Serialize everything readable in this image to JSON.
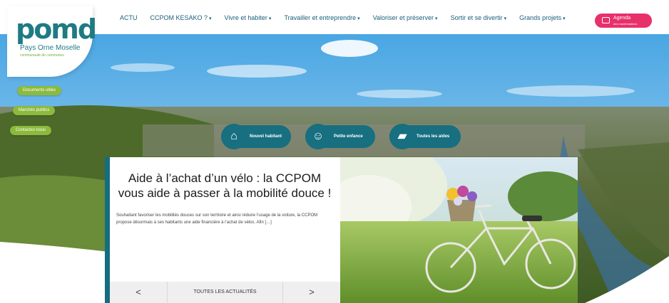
{
  "logo": {
    "mark": "pomd",
    "name": "Pays Orne Moselle",
    "tagline": "communauté de communes"
  },
  "nav": {
    "items": [
      {
        "label": "ACTU",
        "caret": false
      },
      {
        "label": "CCPOM KESAKO ?",
        "caret": true
      },
      {
        "label": "Vivre et habiter",
        "caret": true
      },
      {
        "label": "Travailler et entreprendre",
        "caret": true
      },
      {
        "label": "Valoriser et préserver",
        "caret": true
      },
      {
        "label": "Sortir et se divertir",
        "caret": true
      },
      {
        "label": "Grands projets",
        "caret": true
      }
    ],
    "caret_glyph": "▾"
  },
  "agenda": {
    "label": "Agenda",
    "sublabel": "des manifestations"
  },
  "side_buttons": [
    "Documents utiles",
    "Marchés publics",
    "Contactez-nous"
  ],
  "quick_links": [
    "Nouvel habitant",
    "Petite enfance",
    "Toutes les aides"
  ],
  "article": {
    "title": "Aide à l’achat d’un vélo : la CCPOM vous aide à passer à la mobilité douce !",
    "excerpt": "Souhaitant favoriser les mobilités douces sur son territoire et ainsi réduire l’usage de la voiture, la CCPOM propose désormais à ses habitants une aide financière à l’achat de vélos. Afin […]",
    "prev": "<",
    "all": "TOUTES LES ACTUALITÉS",
    "next": ">"
  },
  "colors": {
    "brand_teal": "#176f80",
    "brand_green": "#8cba3c",
    "agenda_pink": "#e8306b"
  }
}
